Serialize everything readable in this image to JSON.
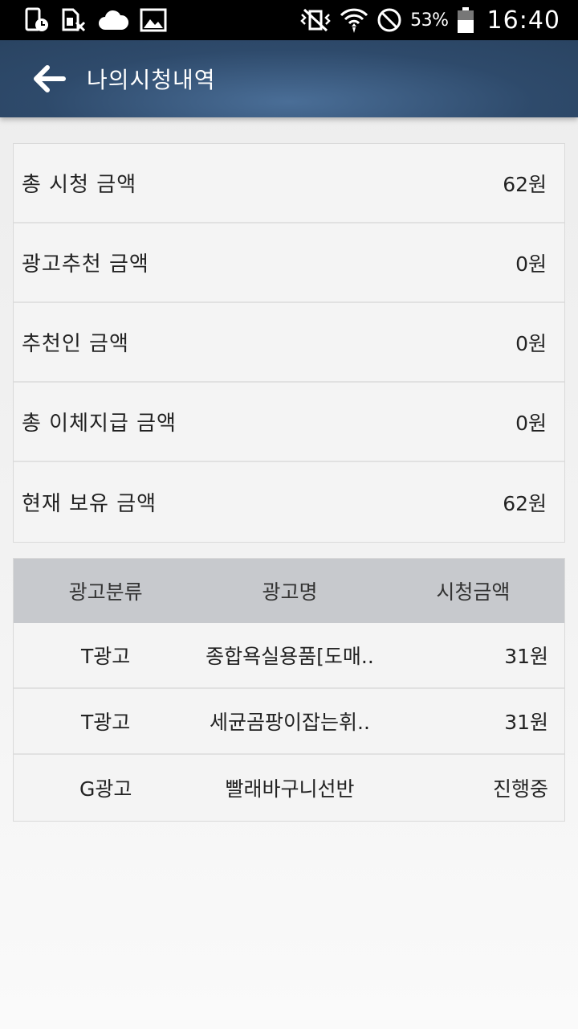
{
  "status_bar": {
    "battery_percent": "53%",
    "time": "16:40"
  },
  "app_bar": {
    "title": "나의시청내역"
  },
  "summary": [
    {
      "label": "총 시청 금액",
      "value": "62원"
    },
    {
      "label": "광고추천 금액",
      "value": "0원"
    },
    {
      "label": "추천인 금액",
      "value": "0원"
    },
    {
      "label": "총 이체지급 금액",
      "value": "0원"
    },
    {
      "label": "현재 보유 금액",
      "value": "62원"
    }
  ],
  "ad_table": {
    "headers": [
      "광고분류",
      "광고명",
      "시청금액"
    ],
    "rows": [
      {
        "category": "T광고",
        "name": "종합욕실용품[도매..",
        "amount": "31원"
      },
      {
        "category": "T광고",
        "name": "세균곰팡이잡는휘..",
        "amount": "31원"
      },
      {
        "category": "G광고",
        "name": "빨래바구니선반",
        "amount": "진행중"
      }
    ]
  }
}
